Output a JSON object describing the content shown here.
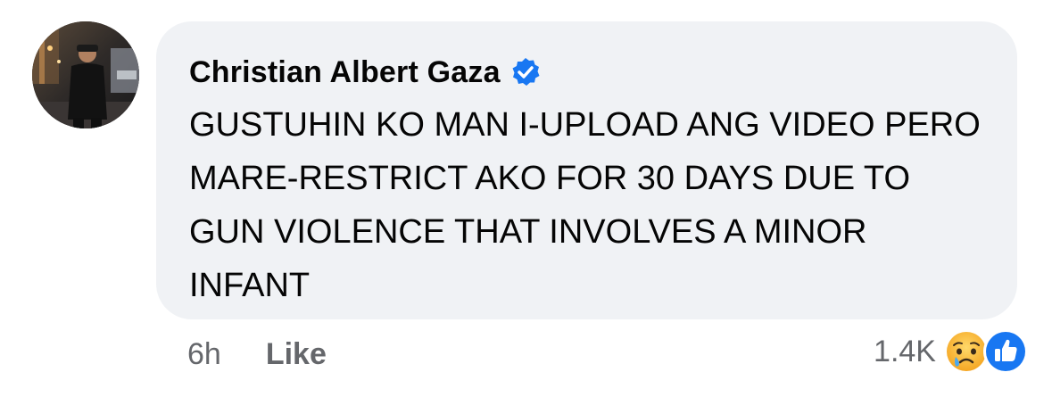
{
  "comment": {
    "author_name": "Christian Albert Gaza",
    "verified_icon": "verified-badge-icon",
    "text": "GUSTUHIN KO MAN I-UPLOAD ANG VIDEO PERO MARE-RESTRICT AKO FOR 30 DAYS DUE TO GUN VIOLENCE THAT INVOLVES A MINOR INFANT",
    "time": "6h",
    "like_label": "Like",
    "reaction_count": "1.4K",
    "reaction_icons": [
      "sad-reaction-icon",
      "like-reaction-icon"
    ]
  },
  "colors": {
    "bubble_bg": "#f0f2f5",
    "text": "#050505",
    "meta_text": "#65676b",
    "verified_blue": "#1877f2",
    "like_blue": "#1877f2",
    "sad_yellow": "#f7b125"
  }
}
